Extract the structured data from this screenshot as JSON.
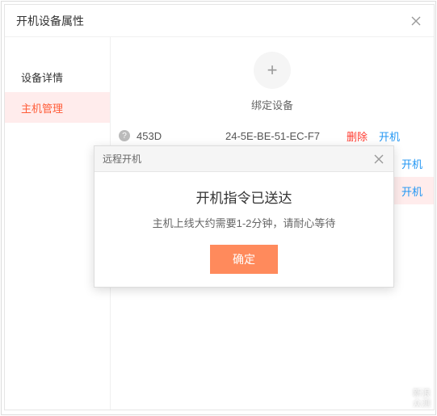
{
  "window": {
    "title": "开机设备属性"
  },
  "sidebar": {
    "items": [
      {
        "label": "设备详情"
      },
      {
        "label": "主机管理"
      }
    ],
    "active_index": 1
  },
  "bind": {
    "label": "绑定设备"
  },
  "devices": [
    {
      "name": "453D",
      "mac": "24-5E-BE-51-EC-F7",
      "delete_label": "删除",
      "power_label": "开机",
      "highlight": false
    },
    {
      "name": "",
      "mac": "",
      "delete_label": "",
      "power_label": "开机",
      "highlight": false
    },
    {
      "name": "",
      "mac": "",
      "delete_label": "",
      "power_label": "开机",
      "highlight": true
    }
  ],
  "modal": {
    "title": "远程开机",
    "heading": "开机指令已送达",
    "sub": "主机上线大约需要1-2分钟，请耐心等待",
    "confirm": "确定"
  },
  "watermark": {
    "line1": "新浪",
    "line2": "众测"
  }
}
